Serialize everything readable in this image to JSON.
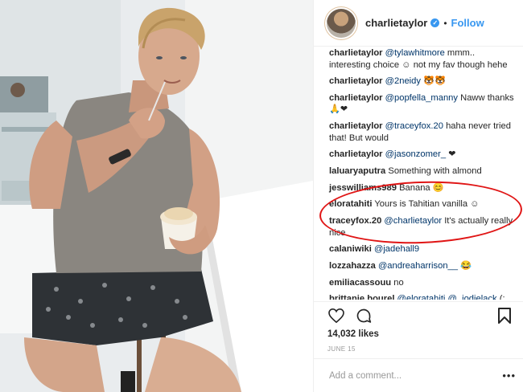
{
  "post": {
    "photo_icon": "ice-cream-photo",
    "header": {
      "username": "charlietaylor",
      "verified_icon": "verified-badge-icon",
      "separator": "•",
      "follow_label": "Follow"
    },
    "comments": [
      {
        "user": "charlietaylor",
        "mention": "@tylawhitmore",
        "text": "mmm.. interesting choice ☺ not my fav though hehe"
      },
      {
        "user": "charlietaylor",
        "mention": "@2neidy",
        "text": "🐯🐯"
      },
      {
        "user": "charlietaylor",
        "mention": "@popfella_manny",
        "text": "Naww thanks 🙏❤"
      },
      {
        "user": "charlietaylor",
        "mention": "@traceyfox.20",
        "text": "haha never tried that! But would"
      },
      {
        "user": "charlietaylor",
        "mention": "@jasonzomer_",
        "text": "❤"
      },
      {
        "user": "laluaryaputra",
        "mention": "",
        "text": "Something with almond"
      },
      {
        "user": "jesswilliams989",
        "mention": "",
        "text": "Banana 😊"
      },
      {
        "user": "eloratahiti",
        "mention": "",
        "text": "Yours is Tahitian vanilla ☺"
      },
      {
        "user": "traceyfox.20",
        "mention": "@charlietaylor",
        "text": "It's actually really nice"
      },
      {
        "user": "calaniwiki",
        "mention": "@jadehall9",
        "text": ""
      },
      {
        "user": "lozzahazza",
        "mention": "@andreaharrison__",
        "text": "😂"
      },
      {
        "user": "emiliacassouu",
        "mention": "",
        "text": "no"
      },
      {
        "user": "brittanie.bourel",
        "mention": "@eloratahiti @_jodielack",
        "text": "(:"
      }
    ],
    "actions": {
      "like_icon": "heart-icon",
      "comment_icon": "comment-bubble-icon",
      "save_icon": "bookmark-icon"
    },
    "likes": "14,032 likes",
    "date": "JUNE 15",
    "add_comment_placeholder": "Add a comment...",
    "more_label": "•••"
  },
  "colors": {
    "link": "#003569",
    "follow": "#3897f0",
    "highlight_ring": "#e01515"
  }
}
